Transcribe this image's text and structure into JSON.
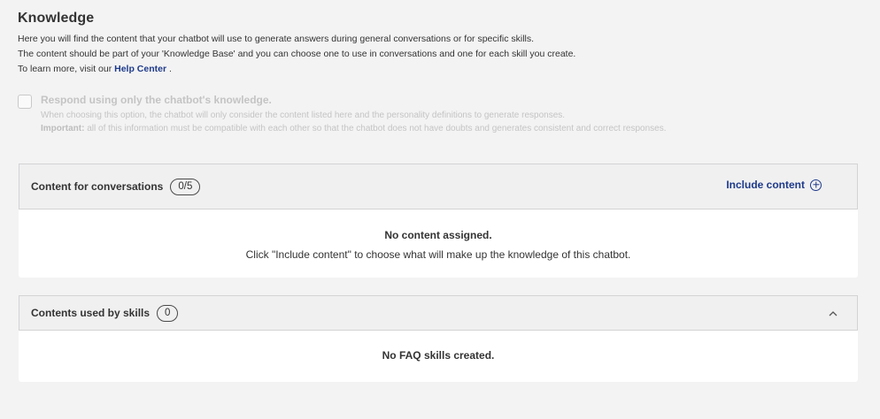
{
  "header": {
    "title": "Knowledge",
    "line1": "Here you will find the content that your chatbot will use to generate answers during general conversations or for specific skills.",
    "line2": "The content should be part of your 'Knowledge Base' and you can choose one to use in conversations and one for each skill you create.",
    "line3_prefix": "To learn more, visit our ",
    "help_link": "Help Center",
    "line3_suffix": " ."
  },
  "option": {
    "label": "Respond using only the chatbot's knowledge.",
    "help1": "When choosing this option, the chatbot will only consider the content listed here and the personality definitions to generate responses.",
    "important_label": "Important:",
    "help2": " all of this information must be compatible with each other so that the chatbot does not have doubts and generates consistent and correct responses.",
    "checked": false
  },
  "conversations": {
    "title": "Content for conversations",
    "count": "0/5",
    "include_label": "Include content",
    "empty_title": "No content assigned.",
    "empty_desc": "Click \"Include content\" to choose what will make up the knowledge of this chatbot."
  },
  "skills": {
    "title": "Contents used by skills",
    "count": "0",
    "empty_title": "No FAQ skills created."
  },
  "colors": {
    "accent": "#1e3a8a",
    "background": "#f3f3f3",
    "panel_header": "#f0f0f1",
    "disabled_text": "#c4c4c4"
  },
  "icons": [
    "plus-circle-icon",
    "chevron-up-icon"
  ]
}
